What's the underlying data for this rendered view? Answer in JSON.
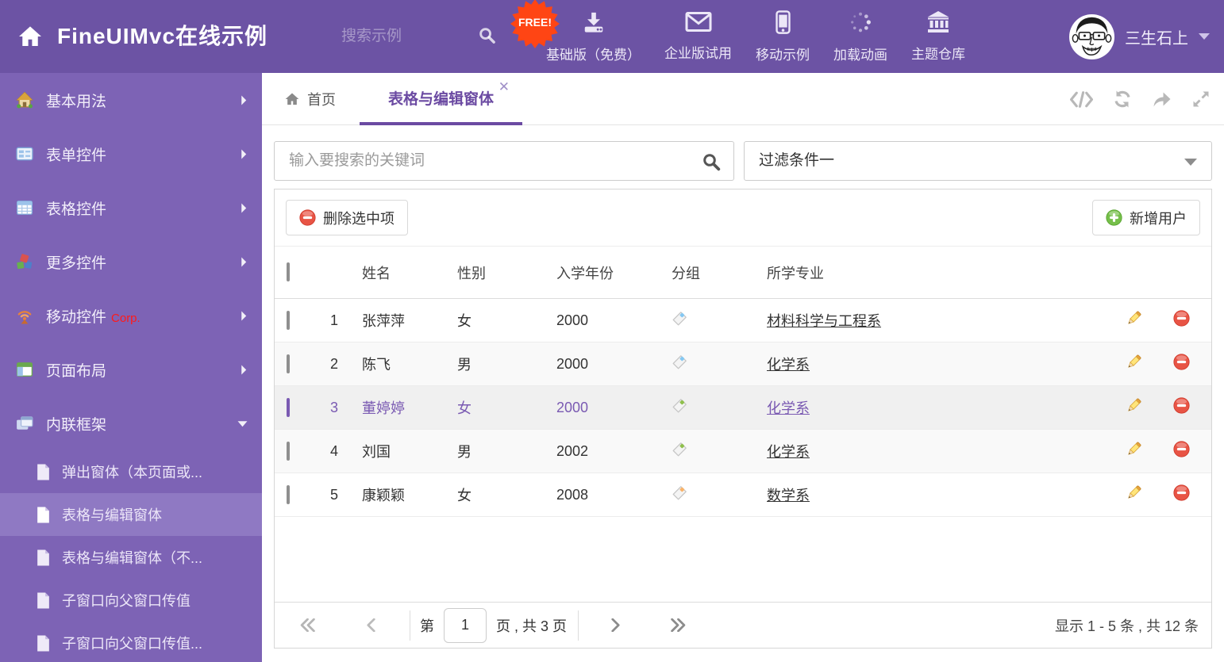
{
  "header": {
    "title": "FineUIMvc在线示例",
    "search_placeholder": "搜索示例",
    "free_badge": "FREE!",
    "nav": [
      {
        "label": "基础版（免费）",
        "icon": "download-icon"
      },
      {
        "label": "企业版试用",
        "icon": "envelope-icon"
      },
      {
        "label": "移动示例",
        "icon": "phone-icon"
      },
      {
        "label": "加载动画",
        "icon": "spinner-icon"
      },
      {
        "label": "主题仓库",
        "icon": "bank-icon"
      }
    ],
    "user_name": "三生石上"
  },
  "sidebar": {
    "groups": [
      {
        "label": "基本用法",
        "icon": "home-icon"
      },
      {
        "label": "表单控件",
        "icon": "form-icon"
      },
      {
        "label": "表格控件",
        "icon": "table-icon"
      },
      {
        "label": "更多控件",
        "icon": "cubes-icon"
      },
      {
        "label": "移动控件",
        "icon": "antenna-icon",
        "badge": "Corp."
      },
      {
        "label": "页面布局",
        "icon": "layout-icon"
      },
      {
        "label": "内联框架",
        "icon": "frames-icon",
        "expanded": true
      }
    ],
    "children": [
      {
        "label": "弹出窗体（本页面或..."
      },
      {
        "label": "表格与编辑窗体",
        "selected": true
      },
      {
        "label": "表格与编辑窗体（不..."
      },
      {
        "label": "子窗口向父窗口传值"
      },
      {
        "label": "子窗口向父窗口传值..."
      }
    ]
  },
  "tabs": {
    "home": "首页",
    "active": "表格与编辑窗体"
  },
  "filter_bar": {
    "search_placeholder": "输入要搜索的关键词",
    "filter_selected": "过滤条件一"
  },
  "grid": {
    "delete_button": "删除选中项",
    "add_button": "新增用户",
    "columns": {
      "name": "姓名",
      "gender": "性别",
      "year": "入学年份",
      "group": "分组",
      "major": "所学专业"
    },
    "rows": [
      {
        "num": "1",
        "name": "张萍萍",
        "gender": "女",
        "year": "2000",
        "tag": "blue",
        "major": "材料科学与工程系"
      },
      {
        "num": "2",
        "name": "陈飞",
        "gender": "男",
        "year": "2000",
        "tag": "blue",
        "major": "化学系"
      },
      {
        "num": "3",
        "name": "董婷婷",
        "gender": "女",
        "year": "2000",
        "tag": "green",
        "major": "化学系",
        "selected": true
      },
      {
        "num": "4",
        "name": "刘国",
        "gender": "男",
        "year": "2002",
        "tag": "green",
        "major": "化学系"
      },
      {
        "num": "5",
        "name": "康颖颖",
        "gender": "女",
        "year": "2008",
        "tag": "orange",
        "major": "数学系"
      }
    ],
    "pager": {
      "page_label_before": "第",
      "page_value": "1",
      "page_label_after": "页 , 共 3 页",
      "summary": "显示 1 - 5 条 , 共 12 条"
    }
  },
  "colors": {
    "header_bg": "#6c53a4",
    "sidebar_bg": "#7d63b5",
    "sidebar_active_bg": "#8f79c3",
    "accent_purple": "#6b4aa2",
    "selected_row_text": "#7a5ab2",
    "free_badge_bg": "#ff4514",
    "corp_red": "#ff1a1a",
    "tag_blue": "#85c8f2",
    "tag_green": "#8fbf4d",
    "tag_orange": "#f9b36a"
  }
}
